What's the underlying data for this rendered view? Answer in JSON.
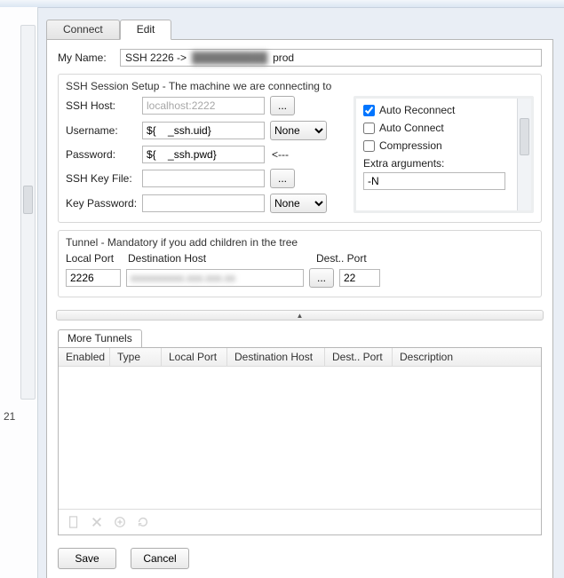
{
  "left_marker": "21",
  "tabs": {
    "connect": "Connect",
    "edit": "Edit"
  },
  "myname": {
    "label": "My Name:",
    "prefix": "SSH 2226 ->",
    "suffix": "prod"
  },
  "ssh": {
    "legend": "SSH Session Setup - The machine we are connecting to",
    "host_label": "SSH Host:",
    "host_placeholder": "localhost:2222",
    "host_value": "",
    "user_label": "Username:",
    "user_value": "${    _ssh.uid}",
    "user_mode": "None",
    "pass_label": "Password:",
    "pass_value": "${    _ssh.pwd}",
    "pass_hint": "<---",
    "keyfile_label": "SSH Key File:",
    "keyfile_value": "",
    "keypass_label": "Key Password:",
    "keypass_value": "",
    "keypass_mode": "None",
    "dots": "..."
  },
  "opts": {
    "auto_reconnect": "Auto Reconnect",
    "auto_connect": "Auto Connect",
    "compression": "Compression",
    "extra_label": "Extra arguments:",
    "extra_value": "-N"
  },
  "tunnel": {
    "legend": "Tunnel - Mandatory if you add children in the tree",
    "localport_label": "Local Port",
    "desthost_label": "Destination Host",
    "destport_label": "Dest.. Port",
    "localport_value": "2226",
    "desthost_value": "xxxxxxxxxx.xxx.xxx.xx",
    "destport_value": "22"
  },
  "more": {
    "tab": "More Tunnels",
    "cols": {
      "enabled": "Enabled",
      "type": "Type",
      "localport": "Local Port",
      "desthost": "Destination Host",
      "destport": "Dest.. Port",
      "desc": "Description"
    }
  },
  "buttons": {
    "save": "Save",
    "cancel": "Cancel"
  }
}
